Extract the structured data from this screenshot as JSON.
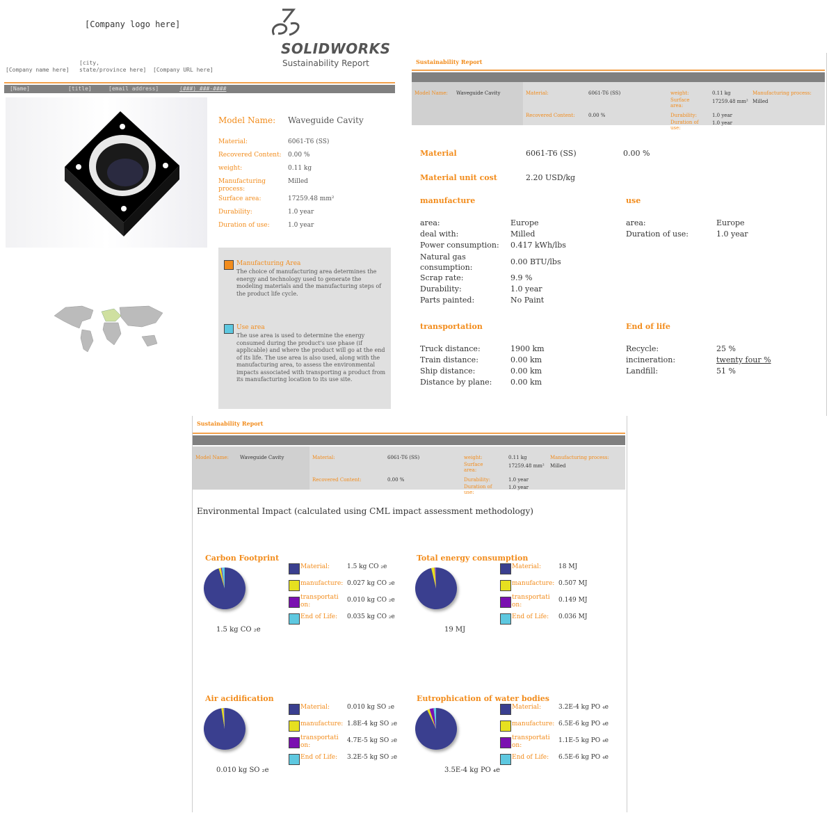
{
  "p1": {
    "logo": "[Company logo here]",
    "brand_main": "SOLIDWORKS",
    "brand_sub": "Sustainability Report",
    "company_name": "[Company name here]",
    "city": "[city,",
    "state": "state/province here]",
    "url": "[Company URL here]",
    "contact_name": "[Name]",
    "contact_title": "[title]",
    "contact_email": "[email address]",
    "contact_phone": "(###) ###-####",
    "model_label": "Model Name:",
    "model_value": "Waveguide Cavity",
    "fields": [
      {
        "label": "Material:",
        "value": "6061-T6 (SS)"
      },
      {
        "label": "Recovered Content:",
        "value": "0.00 %"
      },
      {
        "label": "weight:",
        "value": "0.11 kg"
      },
      {
        "label": "Manufacturing process:",
        "value": "Milled"
      },
      {
        "label": "Surface area:",
        "value": "17259.48 mm²"
      },
      {
        "label": "Durability:",
        "value": "1.0 year"
      },
      {
        "label": "Duration of use:",
        "value": "1.0 year"
      }
    ],
    "mfg_title": "Manufacturing Area",
    "mfg_text": "The choice of manufacturing area determines the energy and technology used to generate the modeling materials and the manufacturing steps of the product life cycle.",
    "use_title": "Use area",
    "use_text": "The use area is used to determine the energy consumed during the product's use phase (if applicable) and where the product will go at the end of its life. The use area is also used, along with the manufacturing area, to assess the environmental impacts associated with transporting a product from its manufacturing location to its use site."
  },
  "hdr": {
    "report_title": "Sustainability Report",
    "model_label": "Model Name:",
    "model_value": "Waveguide Cavity",
    "material_label": "Material:",
    "material_value": "6061-T6 (SS)",
    "recovered_label": "Recovered Content:",
    "recovered_value": "0.00 %",
    "weight_label": "weight:",
    "weight_value": "0.11 kg",
    "process_label": "Manufacturing process:",
    "process_value": "Milled",
    "surface_label": "Surface area:",
    "surface_value": "17259.48 mm²",
    "durability_label": "Durability:",
    "durability_value": "1.0 year",
    "duration_label": "Duration of use:",
    "duration_value": "1.0 year"
  },
  "p2": {
    "material_h": "Material",
    "material_v": "6061-T6 (SS)",
    "material_pct": "0.00 %",
    "cost_h": "Material unit cost",
    "cost_v": "2.20 USD/kg",
    "manufacture_h": "manufacture",
    "use_h": "use",
    "manufacture_rows": [
      {
        "label": "area:",
        "value": "Europe"
      },
      {
        "label": "deal with:",
        "value": "Milled"
      },
      {
        "label": "Power consumption:",
        "value": "0.417 kWh/lbs"
      },
      {
        "label": "Natural gas consumption:",
        "value": "0.00 BTU/lbs"
      },
      {
        "label": "Scrap rate:",
        "value": "9.9 %"
      },
      {
        "label": "Durability:",
        "value": "1.0 year"
      },
      {
        "label": "Parts painted:",
        "value": "No Paint"
      }
    ],
    "use_rows": [
      {
        "label": "area:",
        "value": "Europe"
      },
      {
        "label": "Duration of use:",
        "value": "1.0 year"
      }
    ],
    "transport_h": "transportation",
    "transport_rows": [
      {
        "label": "Truck distance:",
        "value": "1900 km"
      },
      {
        "label": "Train distance:",
        "value": "0.00 km"
      },
      {
        "label": "Ship distance:",
        "value": "0.00 km"
      },
      {
        "label": "Distance by plane:",
        "value": "0.00 km"
      }
    ],
    "eol_h": "End of life",
    "eol_rows": [
      {
        "label": "Recycle:",
        "value": "25 %"
      },
      {
        "label": "incineration:",
        "value": "twenty four %"
      },
      {
        "label": "Landfill:",
        "value": "51 %"
      }
    ]
  },
  "p3": {
    "env_title": "Environmental Impact (calculated using CML impact assessment methodology)",
    "legend_labels": [
      "Material:",
      "manufacture:",
      "transportati on:",
      "End of Life:"
    ],
    "colors": [
      "#3a3f8f",
      "#e6e020",
      "#7a10b0",
      "#5ec8e0"
    ]
  },
  "chart_data": [
    {
      "type": "pie",
      "title": "Carbon Footprint",
      "total": "1.5 kg CO ₂e",
      "categories": [
        "Material:",
        "manufacture:",
        "transportati on:",
        "End of Life:"
      ],
      "labels": [
        "1.5 kg CO ₂e",
        "0.027 kg CO ₂e",
        "0.010 kg CO ₂e",
        "0.035 kg CO ₂e"
      ],
      "values": [
        1.5,
        0.027,
        0.01,
        0.035
      ]
    },
    {
      "type": "pie",
      "title": "Total energy consumption",
      "total": "19 MJ",
      "categories": [
        "Material:",
        "manufacture:",
        "transportati on:",
        "End of Life:"
      ],
      "labels": [
        "18 MJ",
        "0.507 MJ",
        "0.149 MJ",
        "0.036 MJ"
      ],
      "values": [
        18,
        0.507,
        0.149,
        0.036
      ]
    },
    {
      "type": "pie",
      "title": "Air acidification",
      "total": "0.010 kg SO ₂e",
      "categories": [
        "Material:",
        "manufacture:",
        "transportati on:",
        "End of Life:"
      ],
      "labels": [
        "0.010 kg SO ₂e",
        "1.8E-4 kg SO ₂e",
        "4.7E-5 kg SO ₂e",
        "3.2E-5 kg SO ₂e"
      ],
      "values": [
        0.01,
        0.00018,
        4.7e-05,
        3.2e-05
      ]
    },
    {
      "type": "pie",
      "title": "Eutrophication of water bodies",
      "total": "3.5E-4 kg PO ₄e",
      "categories": [
        "Material:",
        "manufacture:",
        "transportati on:",
        "End of Life:"
      ],
      "labels": [
        "3.2E-4 kg PO ₄e",
        "6.5E-6 kg PO ₄e",
        "1.1E-5 kg PO ₄e",
        "6.5E-6 kg PO ₄e"
      ],
      "values": [
        0.00032,
        6.5e-06,
        1.1e-05,
        6.5e-06
      ]
    }
  ]
}
